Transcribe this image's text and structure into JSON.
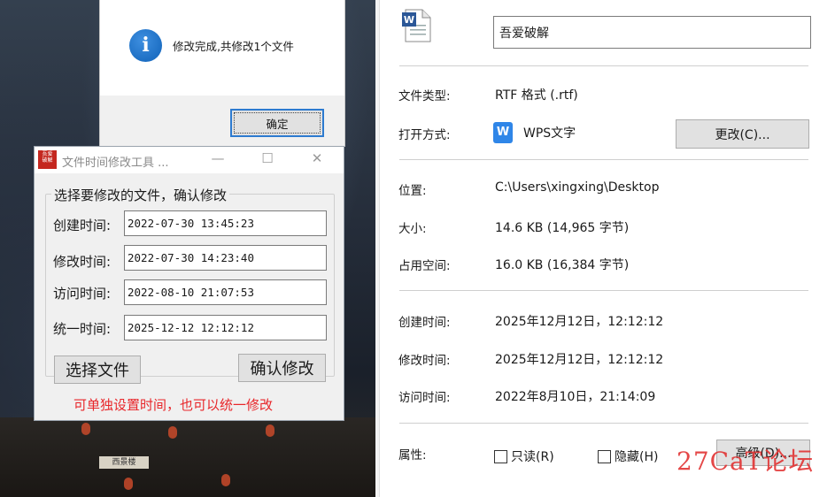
{
  "message_box": {
    "text": "修改完成,共修改1个文件",
    "ok_label": "确定",
    "icon": "info-icon"
  },
  "tool_window": {
    "title": "文件时间修改工具 ...",
    "logo_text": "吾爱破解",
    "minimize": "—",
    "maximize": "☐",
    "close": "✕",
    "group_label": "选择要修改的文件，确认修改",
    "fields": [
      {
        "label": "创建时间:",
        "value": "2022-07-30 13:45:23"
      },
      {
        "label": "修改时间:",
        "value": "2022-07-30 14:23:40"
      },
      {
        "label": "访问时间:",
        "value": "2022-08-10 21:07:53"
      },
      {
        "label": "统一时间:",
        "value": "2025-12-12 12:12:12"
      }
    ],
    "select_file_label": "选择文件",
    "confirm_label": "确认修改",
    "hint": "可单独设置时间，也可以统一修改"
  },
  "properties": {
    "file_name": "吾爱破解",
    "file_icon": "word-document-icon",
    "rows": {
      "type": {
        "label": "文件类型:",
        "value": "RTF 格式 (.rtf)"
      },
      "open_with": {
        "label": "打开方式:",
        "value": "WPS文字",
        "icon_glyph": "W",
        "change_label": "更改(C)..."
      },
      "location": {
        "label": "位置:",
        "value": "C:\\Users\\xingxing\\Desktop"
      },
      "size": {
        "label": "大小:",
        "value": "14.6 KB (14,965 字节)"
      },
      "size_on_disk": {
        "label": "占用空间:",
        "value": "16.0 KB (16,384 字节)"
      },
      "created": {
        "label": "创建时间:",
        "value": "2025年12月12日，12:12:12"
      },
      "modified": {
        "label": "修改时间:",
        "value": "2025年12月12日，12:12:12"
      },
      "accessed": {
        "label": "访问时间:",
        "value": "2022年8月10日，21:14:09"
      }
    },
    "attributes": {
      "label": "属性:",
      "readonly_label": "只读(R)",
      "hidden_label": "隐藏(H)",
      "advanced_label": "高级(D)..."
    }
  },
  "background": {
    "sign_text": "西景楼"
  },
  "watermark": "27CaT论坛",
  "colors": {
    "accent_blue": "#2d7bd0",
    "hint_red": "#e8262a",
    "wps_blue": "#2f86e8",
    "logo_red": "#c4271f"
  }
}
